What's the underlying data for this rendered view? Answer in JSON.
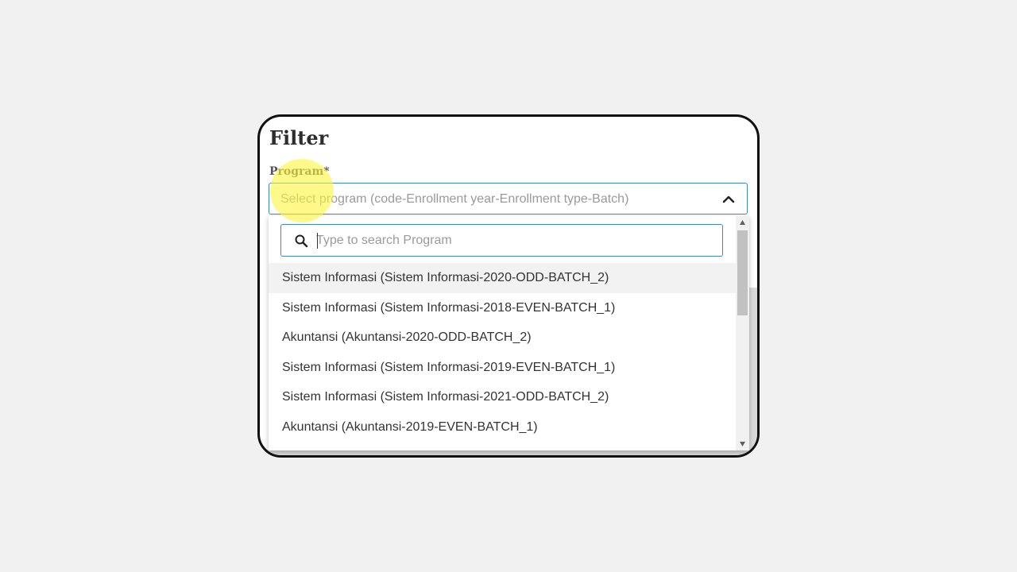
{
  "filter": {
    "title": "Filter",
    "program_label": "Program*",
    "select_placeholder": "Select program (code-Enrollment year-Enrollment type-Batch)",
    "search_placeholder": "Type to search Program",
    "options": [
      "Sistem Informasi (Sistem Informasi-2020-ODD-BATCH_2)",
      "Sistem Informasi (Sistem Informasi-2018-EVEN-BATCH_1)",
      "Akuntansi (Akuntansi-2020-ODD-BATCH_2)",
      "Sistem Informasi (Sistem Informasi-2019-EVEN-BATCH_1)",
      "Sistem Informasi (Sistem Informasi-2021-ODD-BATCH_2)",
      "Akuntansi (Akuntansi-2019-EVEN-BATCH_1)"
    ],
    "highlighted_option_index": 0
  },
  "icons": {
    "select_toggle": "chevron-up-icon",
    "search": "search-icon",
    "scroll_up": "triangle-up-icon",
    "scroll_down": "triangle-down-icon"
  },
  "colors": {
    "accent_border": "#3b88c3",
    "click_highlight": "#fff53c",
    "hover_row": "#f2f2f2"
  }
}
